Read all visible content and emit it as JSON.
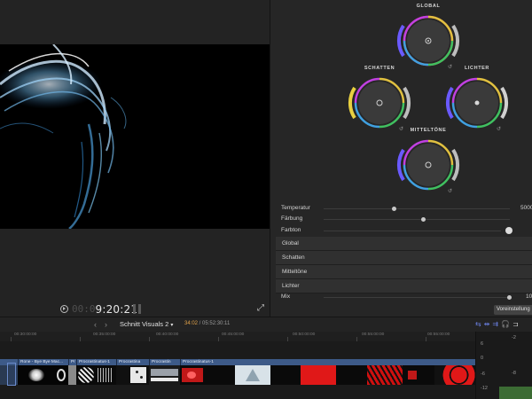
{
  "viewer": {
    "timecode_dim": "00:0",
    "timecode": "9:20:21",
    "fullscreen_icon": "expand-icon"
  },
  "color_board": {
    "wheels": {
      "global": "GLOBAL",
      "shadows": "SCHATTEN",
      "highlights": "LICHTER",
      "midtones": "MITTELTÖNE"
    },
    "params": [
      {
        "label": "Temperatur",
        "value": "5000"
      },
      {
        "label": "Färbung",
        "value": ""
      },
      {
        "label": "Farbton",
        "value": ""
      }
    ],
    "sections": [
      "Global",
      "Schatten",
      "Mitteltöne",
      "Lichter"
    ],
    "mix_label": "Mix",
    "mix_value": "10",
    "preset_button": "Voreinstellung"
  },
  "timeline": {
    "project_name": "Schnitt Visuals 2",
    "position": "34:02",
    "duration": "05:52:30:11",
    "ruler": [
      "00:30:00:00",
      "00:35:00:00",
      "00:40:00:00",
      "00:45:00:00",
      "00:50:00:00",
      "00:55:00:00"
    ],
    "clips": [
      "Rone - Bye Bye Mac...",
      "Pr",
      "Procrastinatus-1",
      "Procrastina",
      "Procrastin",
      "Procrastinatus-1"
    ],
    "meter_scale": [
      "6",
      "0",
      "-6",
      "-12"
    ],
    "meter_scale_right": [
      "-2",
      "-8"
    ]
  },
  "colors": {
    "accent_blue": "#3d5a88",
    "timecode_orange": "#e0a24a",
    "meter_green": "#3c6c34"
  }
}
